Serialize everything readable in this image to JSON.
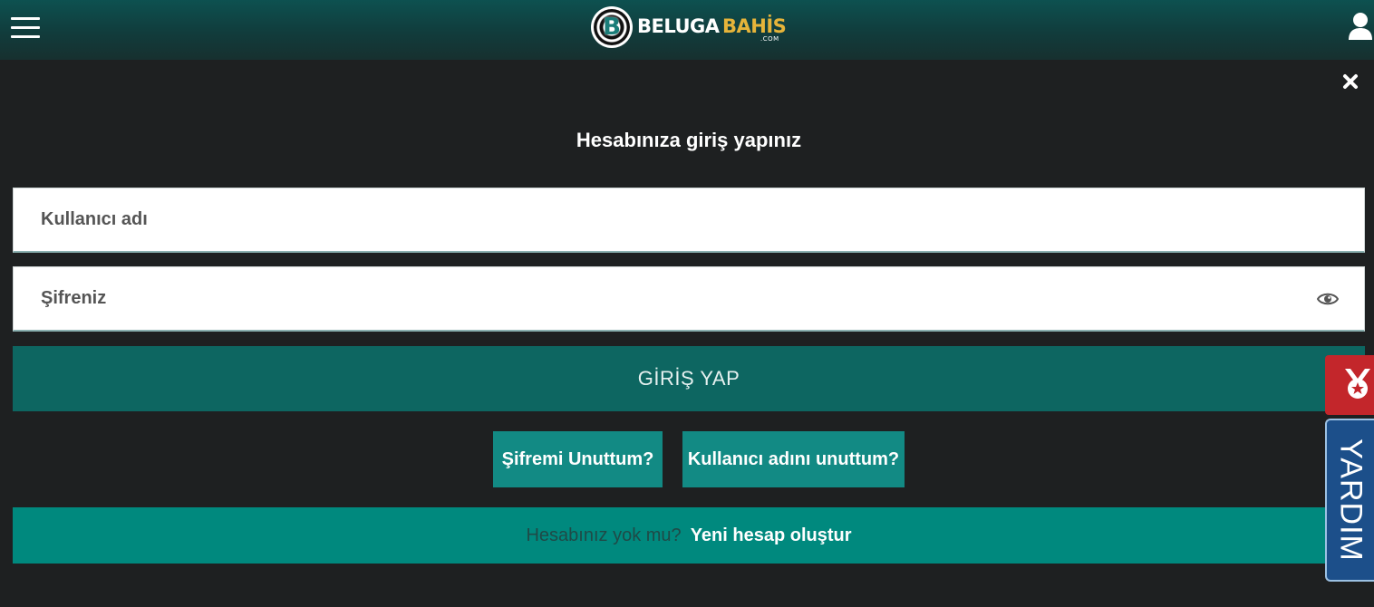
{
  "header": {
    "menu_icon": "hamburger-menu-icon",
    "logo": {
      "word1": "BELUGA",
      "word2": "BAHİS",
      "suffix": ".COM",
      "badge_letter": "B"
    },
    "user_icon": "user-icon",
    "brand_colors": {
      "bar": "#113c3c",
      "logo_accent": "#e6b43a"
    }
  },
  "modal": {
    "close_icon": "close-icon",
    "title": "Hesabınıza giriş yapınız",
    "username": {
      "placeholder": "Kullanıcı adı",
      "value": ""
    },
    "password": {
      "placeholder": "Şifreniz",
      "value": "",
      "toggle_icon": "eye-icon"
    },
    "login_button": "GİRİŞ YAP",
    "forgot_password_button": "Şifremi Unuttum?",
    "forgot_username_button": "Kullanıcı adını unuttum?",
    "signup_question": "Hesabınız yok mu?",
    "signup_link": "Yeni hesap oluştur"
  },
  "side_tabs": {
    "promo_icon": "medal-icon",
    "help_label": "YARDIM"
  },
  "colors": {
    "background": "#1e2021",
    "login_button": "#0d6661",
    "secondary_button": "#128a84",
    "signup_bar": "#00897e",
    "promo_tab": "#c3262b",
    "help_tab": "#1c4f8a"
  }
}
